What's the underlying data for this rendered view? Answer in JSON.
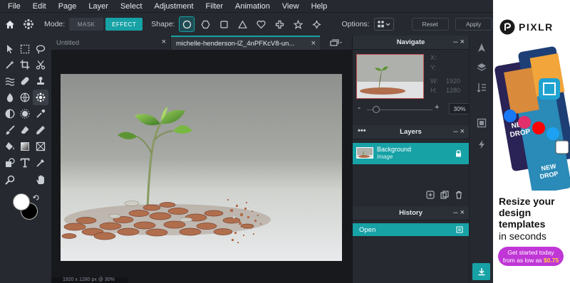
{
  "menu": [
    "File",
    "Edit",
    "Page",
    "Layer",
    "Select",
    "Adjustment",
    "Filter",
    "Animation",
    "View",
    "Help"
  ],
  "options_bar": {
    "mode_label": "Mode:",
    "mask_label": "MASK",
    "effect_label": "EFFECT",
    "shape_label": "Shape:",
    "options_label": "Options:",
    "reset_label": "Reset",
    "apply_label": "Apply"
  },
  "tabs": [
    {
      "label": "Untitled"
    },
    {
      "label": "michelle-henderson-lZ_4nPFKcV8-un..."
    }
  ],
  "status": "1920 x 1280 px @ 30%",
  "navigate": {
    "title": "Navigate",
    "x_label": "X:",
    "y_label": "Y:",
    "w_label": "W:",
    "h_label": "H:",
    "w_value": "1920",
    "h_value": "1280",
    "zoom_value": "30%",
    "zoom_level": 0.1
  },
  "layers": {
    "title": "Layers",
    "items": [
      {
        "name": "Background",
        "type": "Image"
      }
    ]
  },
  "history": {
    "title": "History",
    "items": [
      "Open"
    ]
  },
  "ad": {
    "brand": "PIXLR",
    "headline": "Resize your design templates",
    "sub": "in seconds",
    "cta_line1": "Get started today",
    "cta_line2": "from as low as",
    "cta_price": "$0.75"
  },
  "colors": {
    "accent": "#17a2a6",
    "foreground": "#ffffff",
    "background": "#000000"
  }
}
